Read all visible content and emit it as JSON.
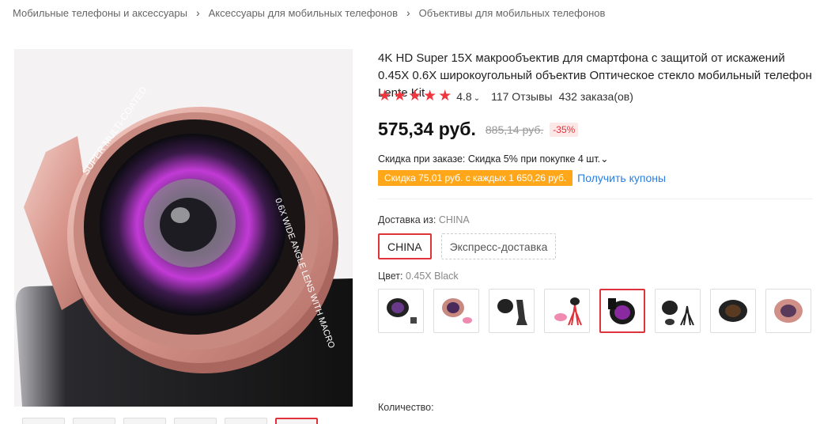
{
  "breadcrumb": [
    "Мобильные телефоны и аксессуары",
    "Аксессуары для мобильных телефонов",
    "Объективы для мобильных телефонов"
  ],
  "breadcrumb_sep": "›",
  "product": {
    "title": "4K HD Super 15X макрообъектив для смартфона с защитой от искажений 0.45X 0.6X широкоугольный объектив Оптическое стекло мобильный телефон Lente Kit",
    "rating": "4.8",
    "rating_chevron": "⌄",
    "stars": 5,
    "reviews": "117 Отзывы",
    "orders": "432 заказа(ов)",
    "price": "575,34 руб.",
    "old_price": "885,14 руб.",
    "discount": "-35%",
    "order_discount": "Скидка при заказе: Скидка 5% при покупке 4 шт.⌄",
    "coupon_badge": "Скидка 75,01 руб. с каждых 1 650,26 руб.",
    "coupon_link": "Получить купоны",
    "lens_text_1": "SUPER MULTI-COATED",
    "lens_text_2": "0.6X WIDE ANGLE LENS WITH MACRO"
  },
  "shipping": {
    "label": "Доставка из:",
    "value": "CHINA",
    "options": [
      "CHINA",
      "Экспресс-доставка"
    ],
    "selected": 0
  },
  "color": {
    "label": "Цвет:",
    "value": "0.45X Black",
    "options_count": 8,
    "selected": 4
  },
  "quantity": {
    "label": "Количество:"
  },
  "colors": {
    "accent": "#e0323b",
    "coupon": "#ffa718",
    "link": "#2a7ee0"
  }
}
